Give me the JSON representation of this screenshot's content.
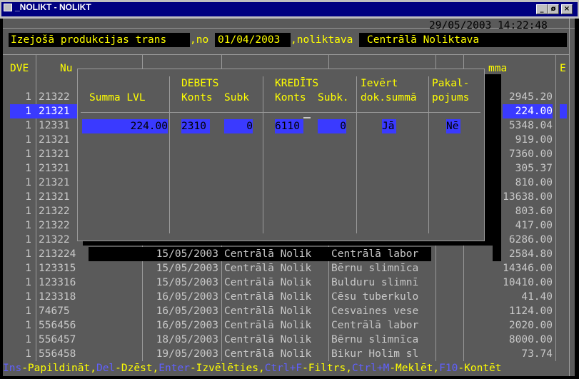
{
  "window": {
    "title": "_NOLIKT - NOLIKT",
    "minimize": "_",
    "restore": "ø",
    "close": "×"
  },
  "datetime": "29/05/2003 14:22:48",
  "header": {
    "label": "Izejošā produkcijas trans",
    "no_label": ",no ",
    "date": "01/04/2003",
    "warehouse_label": ",noliktava ",
    "warehouse": "Centrālā Noliktava"
  },
  "columns": {
    "dve": "DVE",
    "nu": "Nu",
    "summa": "mma",
    "e": "E"
  },
  "rows": [
    {
      "dve": "1",
      "nr": "21322",
      "date": "",
      "wh": "",
      "client": "",
      "sum": "2945.20"
    },
    {
      "dve": "1",
      "nr": "21321",
      "date": "",
      "wh": "",
      "client": "",
      "sum": "224.00"
    },
    {
      "dve": "1",
      "nr": "12331",
      "date": "",
      "wh": "",
      "client": "",
      "sum": "5348.04"
    },
    {
      "dve": "1",
      "nr": "21321",
      "date": "",
      "wh": "",
      "client": "",
      "sum": "919.00"
    },
    {
      "dve": "1",
      "nr": "21321",
      "date": "",
      "wh": "",
      "client": "",
      "sum": "7360.00"
    },
    {
      "dve": "1",
      "nr": "21321",
      "date": "",
      "wh": "",
      "client": "",
      "sum": "305.37"
    },
    {
      "dve": "1",
      "nr": "21321",
      "date": "",
      "wh": "",
      "client": "",
      "sum": "810.00"
    },
    {
      "dve": "1",
      "nr": "21321",
      "date": "",
      "wh": "",
      "client": "",
      "sum": "13638.00"
    },
    {
      "dve": "1",
      "nr": "21322",
      "date": "",
      "wh": "",
      "client": "",
      "sum": "803.60"
    },
    {
      "dve": "1",
      "nr": "21322",
      "date": "",
      "wh": "",
      "client": "",
      "sum": "417.00"
    },
    {
      "dve": "1",
      "nr": "21322",
      "date": "",
      "wh": "",
      "client": "",
      "sum": "6286.00"
    },
    {
      "dve": "1",
      "nr": "213224",
      "date": "15/05/2003",
      "wh": "Centrālā Nolik",
      "client": "Centrālā labor",
      "sum": "2584.80"
    },
    {
      "dve": "1",
      "nr": "123315",
      "date": "15/05/2003",
      "wh": "Centrālā Nolik",
      "client": "Bērnu slimnīca",
      "sum": "14346.00"
    },
    {
      "dve": "1",
      "nr": "123316",
      "date": "15/05/2003",
      "wh": "Centrālā Nolik",
      "client": "Bulduru slimnī",
      "sum": "10410.00"
    },
    {
      "dve": "1",
      "nr": "123318",
      "date": "16/05/2003",
      "wh": "Centrālā Nolik",
      "client": "Cēsu tuberkulo",
      "sum": "41.40"
    },
    {
      "dve": "1",
      "nr": "74675",
      "date": "16/05/2003",
      "wh": "Centrālā Nolik",
      "client": "Cesvaines vese",
      "sum": "1124.00"
    },
    {
      "dve": "1",
      "nr": "556456",
      "date": "16/05/2003",
      "wh": "Centrālā Nolik",
      "client": "Centrālā labor",
      "sum": "2020.00"
    },
    {
      "dve": "1",
      "nr": "556457",
      "date": "18/05/2003",
      "wh": "Centrālā Nolik",
      "client": "Bērnu slimnīca",
      "sum": "8000.00"
    },
    {
      "dve": "1",
      "nr": "556458",
      "date": "19/05/2003",
      "wh": "Centrālā Nolik",
      "client": "Bikur Holim sl",
      "sum": "73.74"
    }
  ],
  "dialog": {
    "summa_label": "Summa LVL",
    "debets_label": "DEBETS",
    "debets_konts_label": "Konts",
    "debets_subk_label": "Subk",
    "kredits_label": "KREDĪTS",
    "kredits_konts_label": "Konts",
    "kredits_subk_label": "Subk.",
    "ievert_label1": "Ievērt",
    "ievert_label2": "dok.summā",
    "pak_label1": "Pakal-",
    "pak_label2": "pojums",
    "summa_value": "224.00",
    "debets_konts": "2310",
    "debets_subk": "0",
    "kredits_konts": "6110",
    "kredits_subk": "0",
    "ievert_value": "Jā",
    "pak_value": "Nē"
  },
  "statusbar": [
    {
      "key": "Ins",
      "action": "-Papildināt,"
    },
    {
      "key": "Del",
      "action": "-Dzēst,"
    },
    {
      "key": "Enter",
      "action": "-Izvēlēties,"
    },
    {
      "key": "Ctrl+F",
      "action": "-Filtrs,"
    },
    {
      "key": "Ctrl+M",
      "action": "-Meklēt,"
    },
    {
      "key": "F10",
      "action": "-Kontēt"
    }
  ],
  "colors": {
    "bg": "#5a5a5a",
    "highlight": "#3a3aff",
    "yellow": "#ffff00",
    "titlebar": "#000080"
  }
}
